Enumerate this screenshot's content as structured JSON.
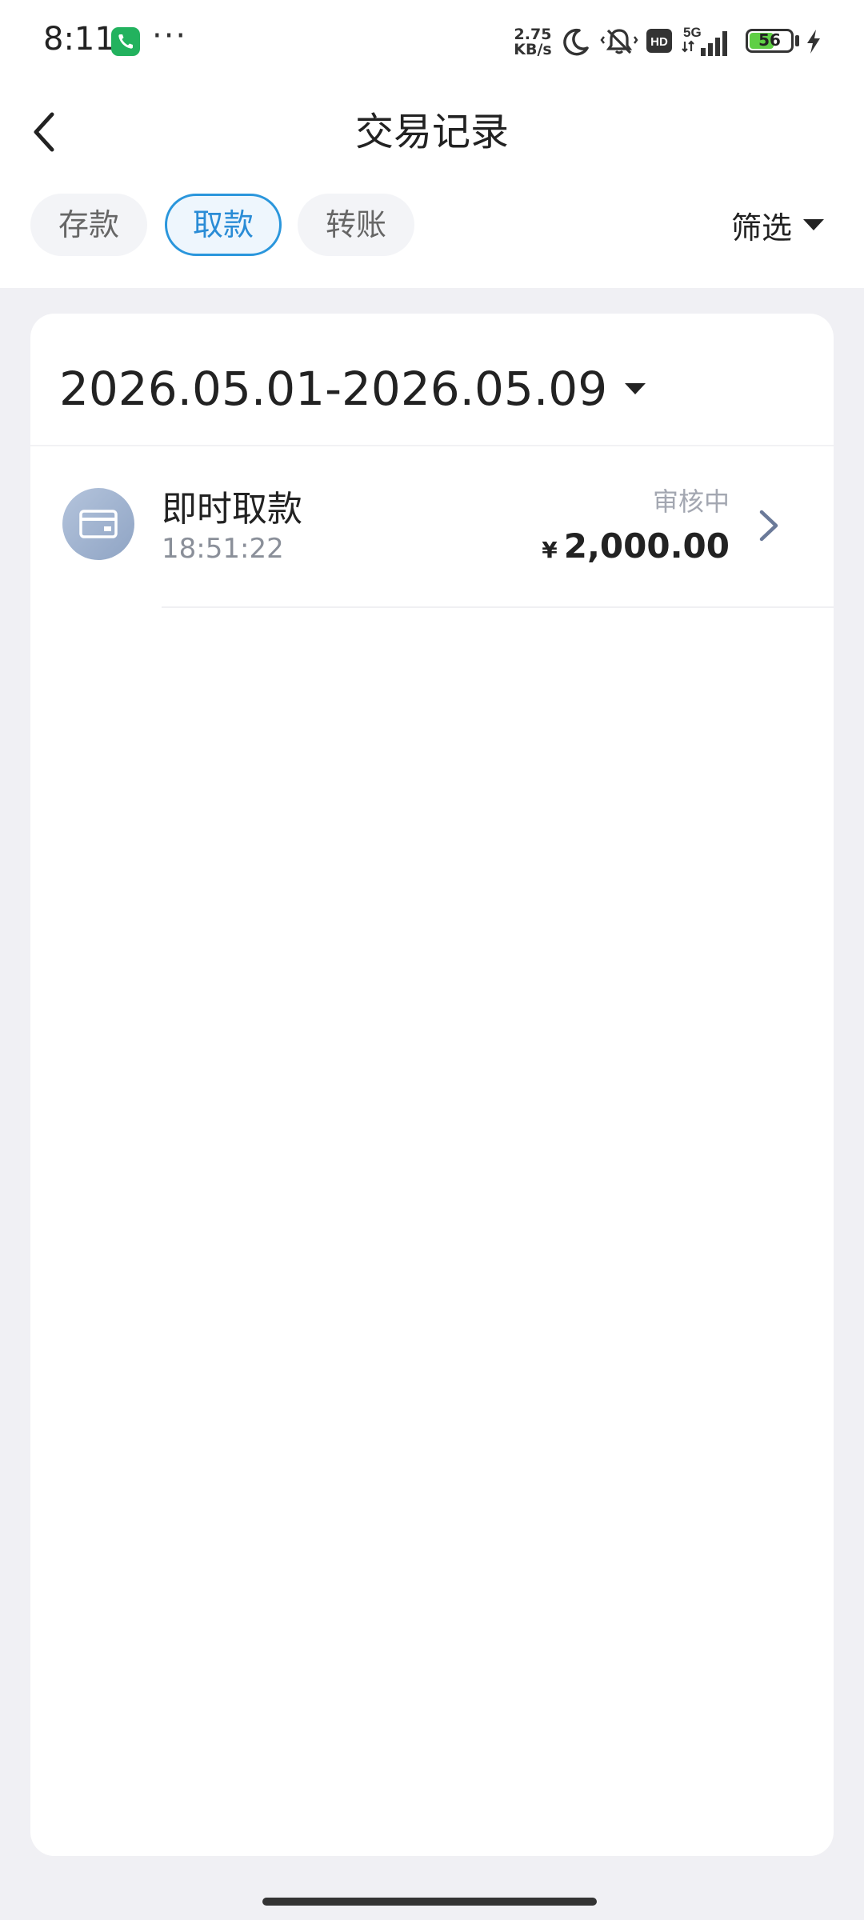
{
  "status_bar": {
    "time": "8:11",
    "dots": "···",
    "net_speed_value": "2.75",
    "net_speed_unit": "KB/s",
    "network": "5G",
    "hd": "HD",
    "battery": "56"
  },
  "header": {
    "title": "交易记录",
    "back_icon": "chevron-left-icon"
  },
  "tabs": [
    {
      "label": "存款",
      "active": false
    },
    {
      "label": "取款",
      "active": true
    },
    {
      "label": "转账",
      "active": false
    }
  ],
  "filter": {
    "label": "筛选"
  },
  "date_range": "2026.05.01-2026.05.09",
  "transactions": [
    {
      "name": "即时取款",
      "time": "18:51:22",
      "status": "审核中",
      "currency": "¥",
      "amount": "2,000.00",
      "icon": "card-icon"
    }
  ],
  "colors": {
    "accent": "#2a96dc",
    "background": "#f0f0f4",
    "battery_fill": "#5fcf45",
    "call_badge": "#22b25e"
  }
}
